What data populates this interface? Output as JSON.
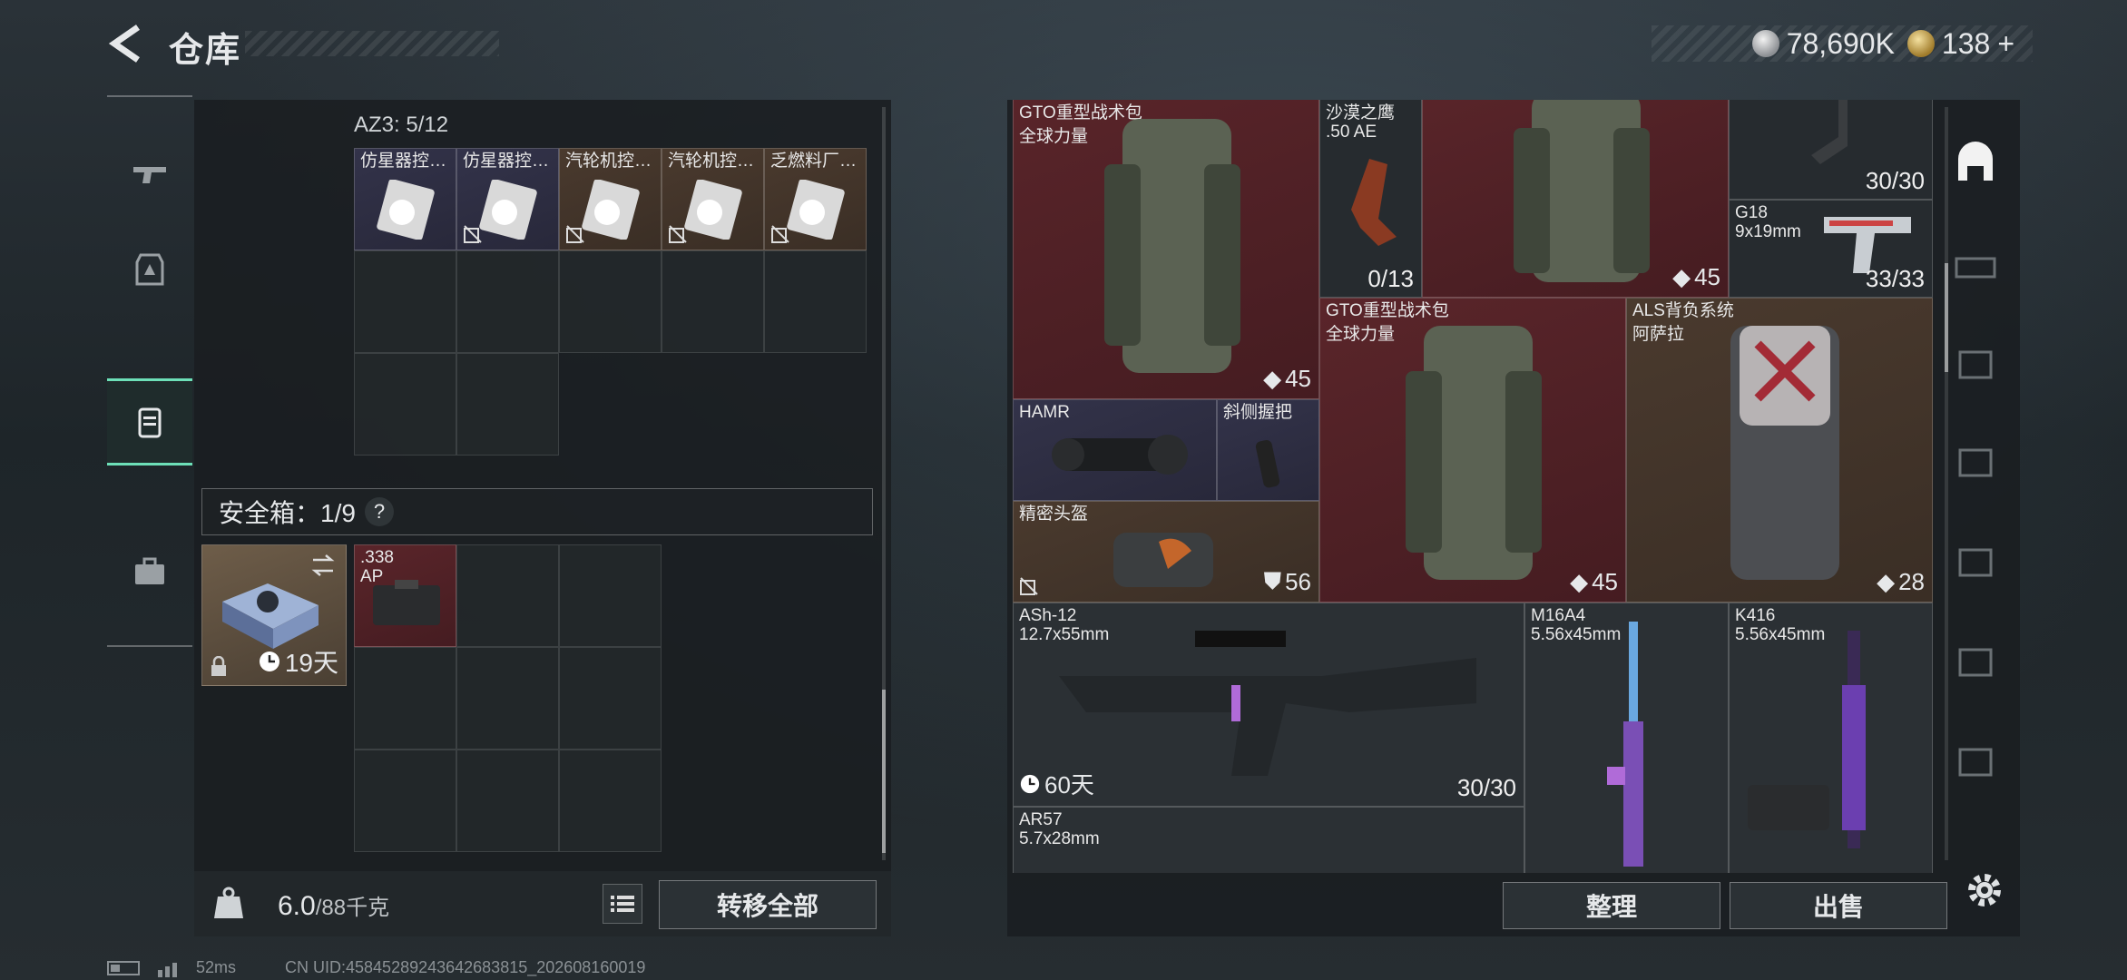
{
  "header": {
    "title": "仓库",
    "silver_amount": "78,690K",
    "gold_amount": "138",
    "gold_plus": "+"
  },
  "left_panel": {
    "az3_label": "AZ3: 5/12",
    "az3_items": [
      {
        "label": "仿星器控…"
      },
      {
        "label": "仿星器控…"
      },
      {
        "label": "汽轮机控…"
      },
      {
        "label": "汽轮机控…"
      },
      {
        "label": "乏燃料厂…"
      }
    ],
    "safe_box_label": "安全箱：1/9",
    "safe_box_help": "?",
    "safe_box_days": "19天",
    "safe_item_label": ".338",
    "safe_item_sub": "AP",
    "weight_value": "6.0",
    "weight_max": "/88千克",
    "transfer_all": "转移全部"
  },
  "right_panel": {
    "items": {
      "backpack1_label": "GTO重型战术包",
      "backpack1_sub": "全球力量",
      "backpack1_count": "45",
      "deagle_label": "沙漠之鹰",
      "deagle_sub": ".50 AE",
      "deagle_count": "0/13",
      "backpack2_count": "45",
      "mag_count": "30/30",
      "g18_label": "G18",
      "g18_sub": "9x19mm",
      "g18_count": "33/33",
      "hamr_label": "HAMR",
      "grip_label": "斜侧握把",
      "helmet_label": "精密头盔",
      "helmet_count": "56",
      "backpack3_label": "GTO重型战术包",
      "backpack3_sub": "全球力量",
      "backpack3_count": "45",
      "als_label": "ALS背负系统",
      "als_sub": "阿萨拉",
      "als_count": "28",
      "ash12_label": "ASh-12",
      "ash12_sub": "12.7x55mm",
      "ash12_days": "60天",
      "ash12_count": "30/30",
      "m16_label": "M16A4",
      "m16_sub": "5.56x45mm",
      "k416_label": "K416",
      "k416_sub": "5.56x45mm",
      "ar57_label": "AR57",
      "ar57_sub": "5.7x28mm"
    },
    "sort": "整理",
    "sell": "出售"
  },
  "status": {
    "ping": "52ms",
    "uid": "CN UID:4584528924364268381​5_202608160019"
  },
  "colors": {
    "accent": "#6de0b8",
    "red_slot": "#5a252a",
    "purple_slot": "#33334a",
    "brown_slot": "#4a3a2e"
  }
}
